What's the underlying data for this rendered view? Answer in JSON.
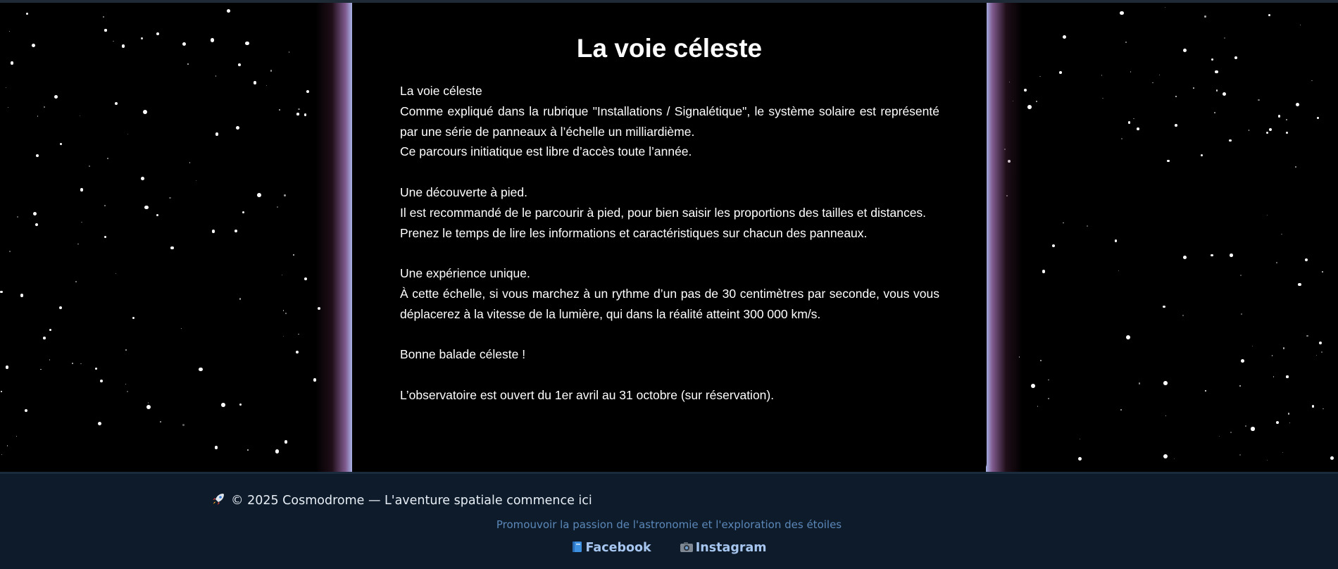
{
  "main": {
    "title": "La voie céleste",
    "paragraphs": {
      "p1": "La voie céleste",
      "p2": "Comme expliqué dans la rubrique \"Installations / Signalétique\", le système solaire est représenté par une série de panneaux à l’échelle un milliardième.",
      "p3": "Ce parcours initiatique est libre d’accès toute l’année.",
      "p4": "Une découverte à pied.",
      "p5": "Il est recommandé de le parcourir à pied, pour bien saisir les proportions des tailles et distances.",
      "p6": "Prenez le temps de lire les informations et caractéristiques sur chacun des panneaux.",
      "p7": "Une expérience unique.",
      "p8": "À cette échelle, si vous marchez à un rythme d’un pas de 30 centimètres par seconde, vous vous déplacerez à la vitesse de la lumière, qui dans la réalité atteint 300 000 km/s.",
      "p9": "Bonne balade céleste !",
      "p10": "L’observatoire est ouvert du 1er avril au 31 octobre (sur réservation)."
    }
  },
  "footer": {
    "copyright": "© 2025 Cosmodrome — L'aventure spatiale commence ici",
    "tagline": "Promouvoir la passion de l'astronomie et l'exploration des étoiles",
    "links": {
      "facebook": "Facebook",
      "instagram": "Instagram"
    },
    "icons": {
      "copyright": "rocket-icon",
      "facebook": "book-icon",
      "instagram": "camera-icon"
    }
  },
  "colors": {
    "background": "#000000",
    "footer_background": "#0e1b2a",
    "footer_tagline": "#5b88b9",
    "footer_links": "#a6c6f0",
    "panel_glow": "#a8b2e6"
  }
}
